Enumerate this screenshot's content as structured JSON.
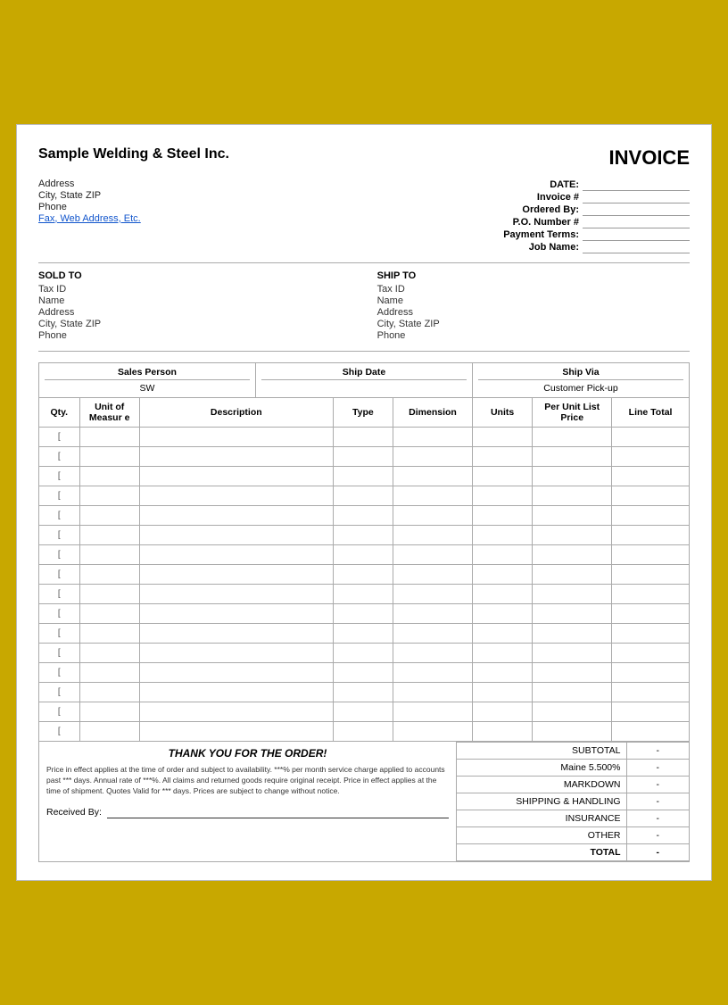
{
  "company": {
    "name": "Sample Welding & Steel Inc.",
    "address": "Address",
    "city_state_zip": "City, State ZIP",
    "phone": "Phone",
    "fax_web": "Fax, Web Address, Etc."
  },
  "invoice_title": "INVOICE",
  "invoice_meta": {
    "date_label": "DATE:",
    "date_value": "",
    "invoice_num_label": "Invoice #",
    "invoice_num_value": "",
    "ordered_by_label": "Ordered By:",
    "ordered_by_value": "",
    "po_number_label": "P.O. Number #",
    "po_number_value": "",
    "payment_terms_label": "Payment Terms:",
    "payment_terms_value": "",
    "job_name_label": "Job Name:",
    "job_name_value": ""
  },
  "sold_to": {
    "title": "SOLD TO",
    "tax_id": "Tax ID",
    "name": "Name",
    "address": "Address",
    "city_state_zip": "City, State ZIP",
    "phone": "Phone"
  },
  "ship_to": {
    "title": "SHIP TO",
    "tax_id": "Tax ID",
    "name": "Name",
    "address": "Address",
    "city_state_zip": "City, State ZIP",
    "phone": "Phone"
  },
  "shipping": {
    "sales_person_label": "Sales Person",
    "sales_person_value": "SW",
    "ship_date_label": "Ship Date",
    "ship_date_value": "",
    "ship_via_label": "Ship Via",
    "ship_via_value": "Customer Pick-up"
  },
  "table": {
    "headers": [
      "Qty.",
      "Unit of Measure",
      "Description",
      "Type",
      "Dimension",
      "Units",
      "Per Unit List Price",
      "Line Total"
    ],
    "rows": [
      [
        "[",
        "",
        "",
        "",
        "",
        "",
        "",
        ""
      ],
      [
        "[",
        "",
        "",
        "",
        "",
        "",
        "",
        ""
      ],
      [
        "[",
        "",
        "",
        "",
        "",
        "",
        "",
        ""
      ],
      [
        "[",
        "",
        "",
        "",
        "",
        "",
        "",
        ""
      ],
      [
        "[",
        "",
        "",
        "",
        "",
        "",
        "",
        ""
      ],
      [
        "[",
        "",
        "",
        "",
        "",
        "",
        "",
        ""
      ],
      [
        "[",
        "",
        "",
        "",
        "",
        "",
        "",
        ""
      ],
      [
        "[",
        "",
        "",
        "",
        "",
        "",
        "",
        ""
      ],
      [
        "[",
        "",
        "",
        "",
        "",
        "",
        "",
        ""
      ],
      [
        "[",
        "",
        "",
        "",
        "",
        "",
        "",
        ""
      ],
      [
        "[",
        "",
        "",
        "",
        "",
        "",
        "",
        ""
      ],
      [
        "[",
        "",
        "",
        "",
        "",
        "",
        "",
        ""
      ],
      [
        "[",
        "",
        "",
        "",
        "",
        "",
        "",
        ""
      ],
      [
        "[",
        "",
        "",
        "",
        "",
        "",
        "",
        ""
      ],
      [
        "[",
        "",
        "",
        "",
        "",
        "",
        "",
        ""
      ],
      [
        "[",
        "",
        "",
        "",
        "",
        "",
        "",
        ""
      ]
    ]
  },
  "footer": {
    "thank_you": "THANK YOU FOR THE ORDER!",
    "fine_print": "Price in effect applies at the time of order and subject to availability. ***% per month service charge applied to accounts past *** days. Annual rate of ***%. All claims and returned goods require original receipt. Price in effect applies at the time of shipment. Quotes Valid for *** days. Prices are subject to change without notice.",
    "received_by_label": "Received By:"
  },
  "totals": {
    "subtotal_label": "SUBTOTAL",
    "subtotal_value": "-",
    "tax_label": "Maine  5.500%",
    "tax_value": "-",
    "markdown_label": "MARKDOWN",
    "markdown_value": "-",
    "shipping_label": "SHIPPING & HANDLING",
    "shipping_value": "-",
    "insurance_label": "INSURANCE",
    "insurance_value": "-",
    "other_label": "OTHER",
    "other_value": "-",
    "total_label": "TOTAL",
    "total_value": "-"
  }
}
